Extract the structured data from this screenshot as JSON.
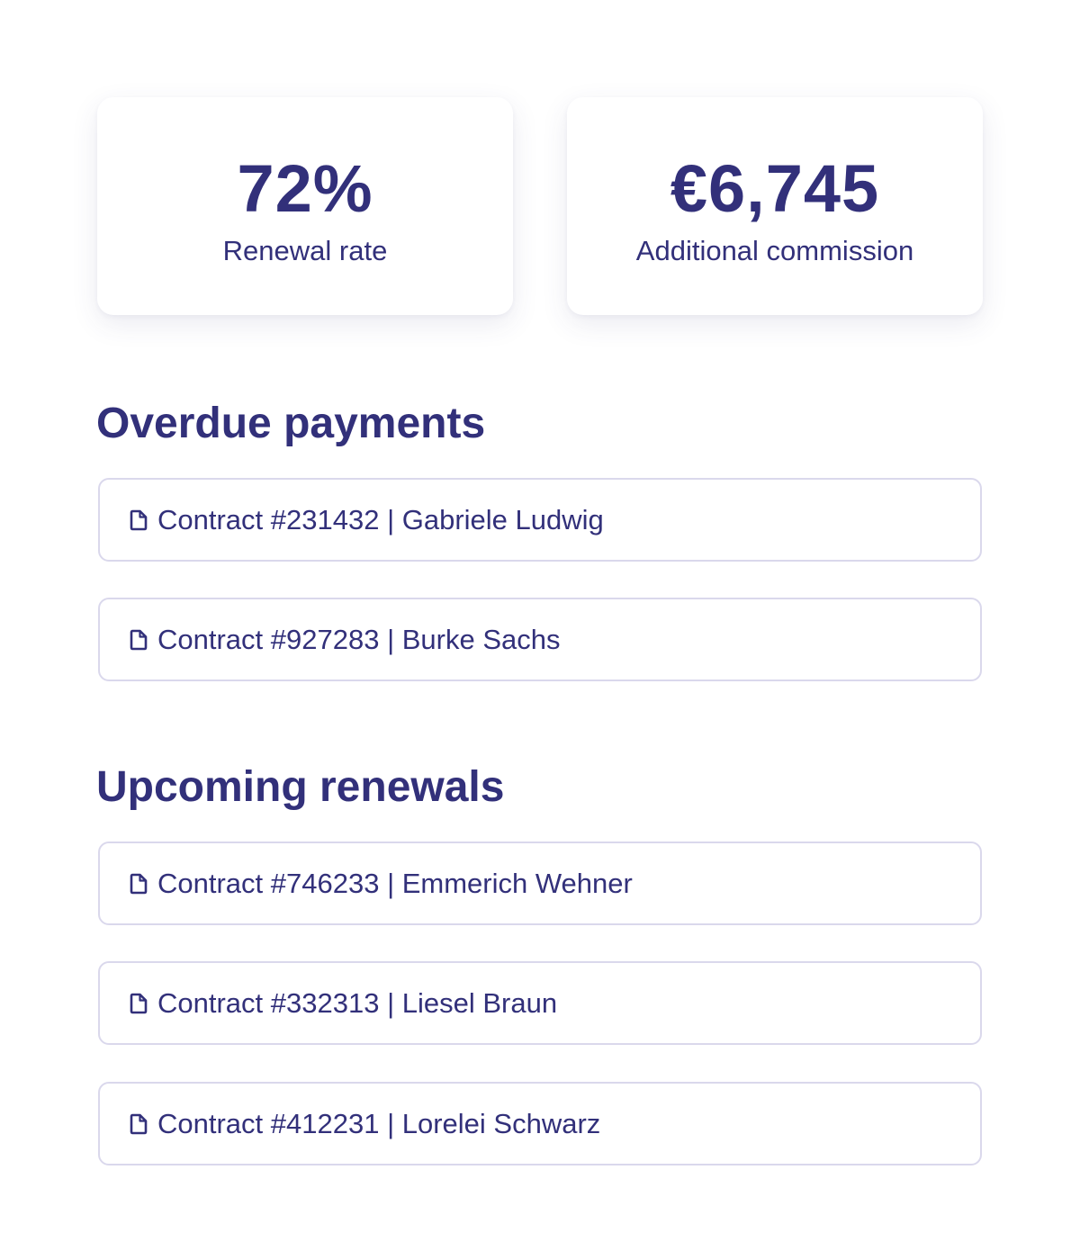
{
  "stats": {
    "renewal": {
      "value": "72%",
      "label": "Renewal rate"
    },
    "commission": {
      "value": "€6,745",
      "label": "Additional commission"
    }
  },
  "overdue": {
    "title": "Overdue payments",
    "items": [
      {
        "icon": "document-icon",
        "label": "Contract #231432 | Gabriele Ludwig"
      },
      {
        "icon": "document-icon",
        "label": "Contract #927283 | Burke Sachs"
      }
    ]
  },
  "renewals": {
    "title": "Upcoming renewals",
    "items": [
      {
        "icon": "document-icon",
        "label": "Contract #746233 | Emmerich Wehner"
      },
      {
        "icon": "document-icon",
        "label": "Contract #332313 | Liesel Braun"
      },
      {
        "icon": "document-icon",
        "label": "Contract #412231 | Lorelei Schwarz"
      }
    ]
  },
  "colors": {
    "text": "#32307a",
    "row_border": "#dad8ec",
    "background": "#ffffff"
  }
}
